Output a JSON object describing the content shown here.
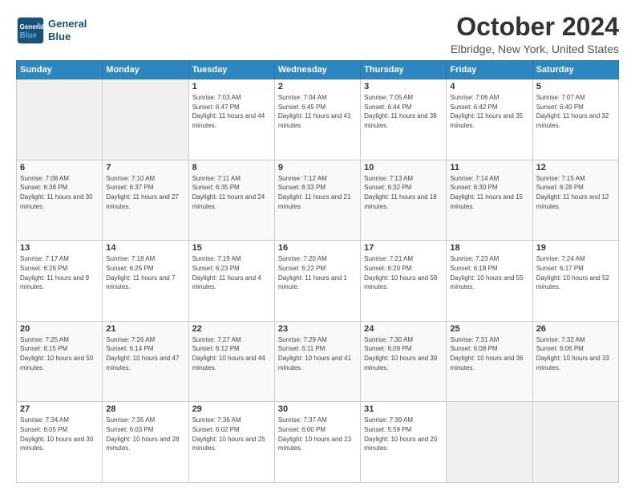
{
  "header": {
    "logo_line1": "General",
    "logo_line2": "Blue",
    "title": "October 2024",
    "location": "Elbridge, New York, United States"
  },
  "days_of_week": [
    "Sunday",
    "Monday",
    "Tuesday",
    "Wednesday",
    "Thursday",
    "Friday",
    "Saturday"
  ],
  "weeks": [
    [
      {
        "day": "",
        "detail": ""
      },
      {
        "day": "",
        "detail": ""
      },
      {
        "day": "1",
        "detail": "Sunrise: 7:03 AM\nSunset: 6:47 PM\nDaylight: 11 hours and 44 minutes."
      },
      {
        "day": "2",
        "detail": "Sunrise: 7:04 AM\nSunset: 6:45 PM\nDaylight: 11 hours and 41 minutes."
      },
      {
        "day": "3",
        "detail": "Sunrise: 7:05 AM\nSunset: 6:44 PM\nDaylight: 11 hours and 38 minutes."
      },
      {
        "day": "4",
        "detail": "Sunrise: 7:06 AM\nSunset: 6:42 PM\nDaylight: 11 hours and 35 minutes."
      },
      {
        "day": "5",
        "detail": "Sunrise: 7:07 AM\nSunset: 6:40 PM\nDaylight: 11 hours and 32 minutes."
      }
    ],
    [
      {
        "day": "6",
        "detail": "Sunrise: 7:08 AM\nSunset: 6:38 PM\nDaylight: 11 hours and 30 minutes."
      },
      {
        "day": "7",
        "detail": "Sunrise: 7:10 AM\nSunset: 6:37 PM\nDaylight: 11 hours and 27 minutes."
      },
      {
        "day": "8",
        "detail": "Sunrise: 7:11 AM\nSunset: 6:35 PM\nDaylight: 11 hours and 24 minutes."
      },
      {
        "day": "9",
        "detail": "Sunrise: 7:12 AM\nSunset: 6:33 PM\nDaylight: 11 hours and 21 minutes."
      },
      {
        "day": "10",
        "detail": "Sunrise: 7:13 AM\nSunset: 6:32 PM\nDaylight: 11 hours and 18 minutes."
      },
      {
        "day": "11",
        "detail": "Sunrise: 7:14 AM\nSunset: 6:30 PM\nDaylight: 11 hours and 15 minutes."
      },
      {
        "day": "12",
        "detail": "Sunrise: 7:15 AM\nSunset: 6:28 PM\nDaylight: 11 hours and 12 minutes."
      }
    ],
    [
      {
        "day": "13",
        "detail": "Sunrise: 7:17 AM\nSunset: 6:26 PM\nDaylight: 11 hours and 9 minutes."
      },
      {
        "day": "14",
        "detail": "Sunrise: 7:18 AM\nSunset: 6:25 PM\nDaylight: 11 hours and 7 minutes."
      },
      {
        "day": "15",
        "detail": "Sunrise: 7:19 AM\nSunset: 6:23 PM\nDaylight: 11 hours and 4 minutes."
      },
      {
        "day": "16",
        "detail": "Sunrise: 7:20 AM\nSunset: 6:22 PM\nDaylight: 11 hours and 1 minute."
      },
      {
        "day": "17",
        "detail": "Sunrise: 7:21 AM\nSunset: 6:20 PM\nDaylight: 10 hours and 58 minutes."
      },
      {
        "day": "18",
        "detail": "Sunrise: 7:23 AM\nSunset: 6:18 PM\nDaylight: 10 hours and 55 minutes."
      },
      {
        "day": "19",
        "detail": "Sunrise: 7:24 AM\nSunset: 6:17 PM\nDaylight: 10 hours and 52 minutes."
      }
    ],
    [
      {
        "day": "20",
        "detail": "Sunrise: 7:25 AM\nSunset: 6:15 PM\nDaylight: 10 hours and 50 minutes."
      },
      {
        "day": "21",
        "detail": "Sunrise: 7:26 AM\nSunset: 6:14 PM\nDaylight: 10 hours and 47 minutes."
      },
      {
        "day": "22",
        "detail": "Sunrise: 7:27 AM\nSunset: 6:12 PM\nDaylight: 10 hours and 44 minutes."
      },
      {
        "day": "23",
        "detail": "Sunrise: 7:29 AM\nSunset: 6:11 PM\nDaylight: 10 hours and 41 minutes."
      },
      {
        "day": "24",
        "detail": "Sunrise: 7:30 AM\nSunset: 6:09 PM\nDaylight: 10 hours and 39 minutes."
      },
      {
        "day": "25",
        "detail": "Sunrise: 7:31 AM\nSunset: 6:08 PM\nDaylight: 10 hours and 36 minutes."
      },
      {
        "day": "26",
        "detail": "Sunrise: 7:32 AM\nSunset: 6:06 PM\nDaylight: 10 hours and 33 minutes."
      }
    ],
    [
      {
        "day": "27",
        "detail": "Sunrise: 7:34 AM\nSunset: 6:05 PM\nDaylight: 10 hours and 30 minutes."
      },
      {
        "day": "28",
        "detail": "Sunrise: 7:35 AM\nSunset: 6:03 PM\nDaylight: 10 hours and 28 minutes."
      },
      {
        "day": "29",
        "detail": "Sunrise: 7:36 AM\nSunset: 6:02 PM\nDaylight: 10 hours and 25 minutes."
      },
      {
        "day": "30",
        "detail": "Sunrise: 7:37 AM\nSunset: 6:00 PM\nDaylight: 10 hours and 23 minutes."
      },
      {
        "day": "31",
        "detail": "Sunrise: 7:39 AM\nSunset: 5:59 PM\nDaylight: 10 hours and 20 minutes."
      },
      {
        "day": "",
        "detail": ""
      },
      {
        "day": "",
        "detail": ""
      }
    ]
  ]
}
